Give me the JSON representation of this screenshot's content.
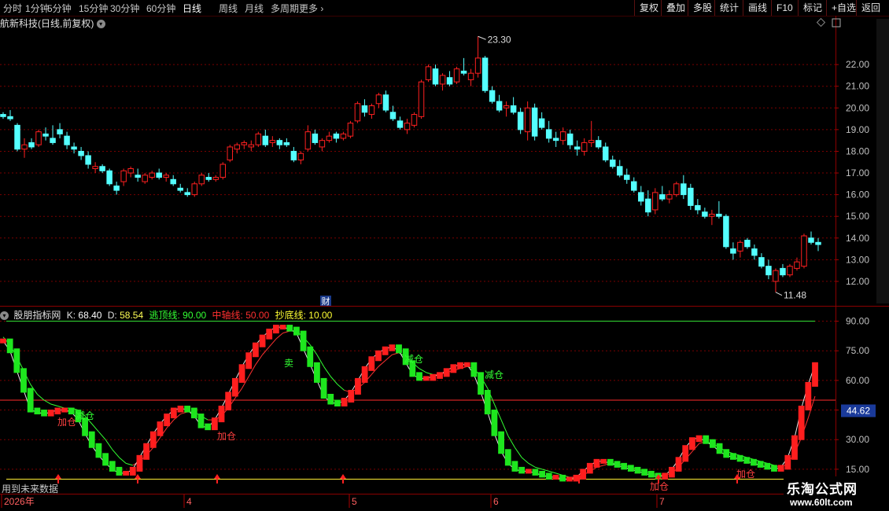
{
  "toolbar": {
    "periods": [
      "分时",
      "1分钟",
      "5分钟",
      "15分钟",
      "30分钟",
      "60分钟",
      "日线",
      "周线",
      "月线",
      "多周期",
      "更多"
    ],
    "active_period": "日线",
    "right_buttons": [
      "复权",
      "叠加",
      "多股",
      "统计",
      "画线",
      "F10",
      "标记",
      "+自选",
      "返回"
    ]
  },
  "main_title": "航新科技(日线,前复权)",
  "price_axis": [
    "22.00",
    "21.00",
    "20.00",
    "19.00",
    "18.00",
    "17.00",
    "16.00",
    "15.00",
    "14.00",
    "13.00",
    "12.00"
  ],
  "high_label": "23.30",
  "low_label": "11.48",
  "finance_marker": "财",
  "indicator": {
    "name": "股朋指标网",
    "k_label": "K:",
    "k_value": "68.40",
    "d_label": "D:",
    "d_value": "58.54",
    "escape_label": "逃顶线:",
    "escape_value": "90.00",
    "mid_label": "中轴线:",
    "mid_value": "50.00",
    "bottom_label": "抄底线:",
    "bottom_value": "10.00",
    "axis": [
      "90.00",
      "75.00",
      "60.00",
      "45.00",
      "30.00",
      "15.00"
    ],
    "current_value": "44.62",
    "annotations": {
      "jia_cang": "加仓",
      "jian_cang": "减仓",
      "mai": "卖"
    }
  },
  "future_data_text": "用到未来数据",
  "date_axis": [
    "2026年",
    "4",
    "5",
    "6",
    "7"
  ],
  "watermark": {
    "title": "乐淘公式网",
    "url": "www.60lt.com"
  },
  "colors": {
    "up": "#ff2020",
    "down": "#54ffff",
    "kd_up": "#ff1e1e",
    "kd_down": "#1ee61e",
    "grid": "#7a0000",
    "axis_text": "#c0c0c0"
  },
  "chart_data": [
    {
      "type": "candlestick",
      "ylim": [
        11.2,
        23.6
      ],
      "high": "23.30",
      "low": "11.48",
      "ohlc": [
        [
          19.7,
          19.8,
          19.5,
          19.6
        ],
        [
          19.6,
          19.9,
          19.4,
          19.5
        ],
        [
          19.2,
          19.3,
          18.0,
          18.1
        ],
        [
          18.1,
          18.6,
          17.7,
          18.3
        ],
        [
          18.4,
          18.6,
          18.1,
          18.2
        ],
        [
          18.3,
          19.0,
          18.2,
          18.9
        ],
        [
          18.8,
          19.1,
          18.5,
          18.7
        ],
        [
          18.6,
          19.2,
          18.3,
          18.4
        ],
        [
          19.0,
          19.3,
          18.6,
          18.8
        ],
        [
          18.7,
          18.9,
          18.1,
          18.3
        ],
        [
          18.2,
          18.4,
          17.9,
          18.1
        ],
        [
          18.0,
          18.2,
          17.6,
          17.8
        ],
        [
          17.8,
          18.0,
          17.2,
          17.4
        ],
        [
          17.2,
          17.5,
          17.0,
          17.3
        ],
        [
          17.3,
          17.4,
          17.0,
          17.1
        ],
        [
          17.1,
          17.2,
          16.4,
          16.5
        ],
        [
          16.4,
          16.6,
          16.0,
          16.2
        ],
        [
          16.6,
          17.2,
          16.4,
          17.1
        ],
        [
          17.0,
          17.3,
          16.8,
          17.2
        ],
        [
          16.9,
          17.2,
          16.6,
          16.8
        ],
        [
          16.6,
          17.0,
          16.5,
          16.9
        ],
        [
          16.8,
          17.1,
          16.7,
          17.0
        ],
        [
          17.0,
          17.2,
          16.7,
          16.8
        ],
        [
          16.8,
          17.0,
          16.6,
          16.9
        ],
        [
          16.7,
          16.9,
          16.4,
          16.5
        ],
        [
          16.3,
          16.5,
          16.1,
          16.2
        ],
        [
          16.1,
          16.3,
          15.9,
          16.0
        ],
        [
          16.0,
          16.6,
          15.9,
          16.5
        ],
        [
          16.5,
          17.0,
          16.4,
          16.9
        ],
        [
          16.8,
          17.0,
          16.6,
          16.7
        ],
        [
          16.7,
          16.9,
          16.6,
          16.8
        ],
        [
          16.8,
          17.5,
          16.7,
          17.4
        ],
        [
          17.6,
          18.3,
          17.5,
          18.2
        ],
        [
          18.1,
          18.4,
          17.9,
          18.3
        ],
        [
          18.3,
          18.5,
          18.1,
          18.4
        ],
        [
          18.2,
          18.5,
          18.0,
          18.3
        ],
        [
          18.3,
          18.9,
          18.2,
          18.8
        ],
        [
          18.7,
          19.0,
          18.2,
          18.3
        ],
        [
          18.4,
          18.7,
          18.2,
          18.5
        ],
        [
          18.5,
          18.6,
          18.1,
          18.3
        ],
        [
          18.4,
          18.6,
          18.2,
          18.3
        ],
        [
          18.0,
          18.2,
          17.5,
          17.6
        ],
        [
          17.6,
          18.0,
          17.4,
          17.9
        ],
        [
          18.1,
          19.2,
          18.0,
          18.9
        ],
        [
          18.8,
          19.0,
          18.3,
          18.4
        ],
        [
          18.2,
          18.6,
          18.0,
          18.5
        ],
        [
          18.5,
          18.9,
          18.4,
          18.7
        ],
        [
          18.8,
          18.9,
          18.4,
          18.6
        ],
        [
          18.6,
          18.9,
          18.5,
          18.8
        ],
        [
          18.7,
          19.4,
          18.6,
          19.3
        ],
        [
          19.4,
          20.3,
          19.3,
          20.2
        ],
        [
          20.1,
          20.4,
          19.6,
          19.8
        ],
        [
          19.7,
          20.2,
          19.5,
          20.1
        ],
        [
          20.2,
          20.7,
          20.0,
          20.6
        ],
        [
          20.6,
          20.8,
          19.8,
          19.9
        ],
        [
          19.8,
          20.1,
          19.4,
          19.5
        ],
        [
          19.4,
          19.6,
          19.0,
          19.1
        ],
        [
          19.0,
          19.5,
          18.8,
          19.3
        ],
        [
          19.2,
          19.8,
          19.1,
          19.7
        ],
        [
          19.6,
          21.3,
          19.5,
          21.2
        ],
        [
          21.3,
          22.0,
          21.2,
          21.9
        ],
        [
          21.8,
          22.0,
          21.0,
          21.1
        ],
        [
          21.1,
          21.6,
          20.8,
          21.5
        ],
        [
          21.4,
          21.7,
          21.0,
          21.1
        ],
        [
          21.2,
          21.9,
          21.1,
          21.8
        ],
        [
          21.7,
          22.3,
          21.5,
          21.6
        ],
        [
          21.3,
          21.8,
          21.0,
          21.6
        ],
        [
          21.6,
          23.3,
          21.4,
          22.3
        ],
        [
          22.3,
          22.4,
          20.7,
          20.8
        ],
        [
          20.8,
          21.0,
          20.2,
          20.3
        ],
        [
          20.3,
          20.6,
          19.8,
          19.9
        ],
        [
          20.0,
          20.3,
          19.6,
          20.1
        ],
        [
          20.1,
          20.5,
          19.7,
          19.8
        ],
        [
          19.8,
          20.0,
          18.8,
          19.0
        ],
        [
          18.9,
          20.3,
          18.5,
          20.0
        ],
        [
          20.0,
          20.2,
          18.5,
          18.7
        ],
        [
          19.5,
          19.8,
          19.0,
          19.1
        ],
        [
          19.0,
          19.4,
          18.4,
          18.6
        ],
        [
          18.6,
          18.9,
          18.2,
          18.5
        ],
        [
          18.5,
          19.1,
          18.3,
          18.9
        ],
        [
          18.8,
          19.0,
          18.1,
          18.3
        ],
        [
          18.2,
          18.5,
          17.8,
          18.1
        ],
        [
          18.0,
          18.6,
          17.8,
          18.4
        ],
        [
          18.4,
          19.4,
          18.2,
          18.5
        ],
        [
          18.5,
          18.7,
          18.1,
          18.2
        ],
        [
          18.2,
          18.4,
          17.5,
          17.6
        ],
        [
          17.6,
          17.8,
          17.2,
          17.3
        ],
        [
          17.3,
          17.6,
          16.8,
          16.9
        ],
        [
          16.9,
          17.2,
          16.5,
          16.7
        ],
        [
          16.6,
          16.8,
          16.1,
          16.2
        ],
        [
          16.1,
          16.4,
          15.5,
          15.7
        ],
        [
          15.8,
          16.2,
          15.0,
          15.2
        ],
        [
          15.3,
          16.3,
          15.1,
          16.1
        ],
        [
          16.0,
          16.4,
          15.7,
          15.8
        ],
        [
          15.8,
          16.2,
          15.6,
          16.0
        ],
        [
          16.0,
          16.6,
          15.9,
          16.5
        ],
        [
          16.5,
          16.9,
          15.8,
          16.0
        ],
        [
          16.3,
          16.5,
          15.3,
          15.5
        ],
        [
          15.5,
          15.8,
          15.1,
          15.3
        ],
        [
          15.2,
          15.4,
          14.9,
          15.0
        ],
        [
          15.0,
          15.3,
          14.6,
          15.1
        ],
        [
          15.1,
          15.7,
          14.9,
          15.0
        ],
        [
          15.0,
          15.1,
          13.5,
          13.6
        ],
        [
          13.5,
          13.8,
          13.0,
          13.3
        ],
        [
          13.4,
          13.9,
          13.1,
          13.8
        ],
        [
          13.9,
          14.0,
          13.5,
          13.6
        ],
        [
          13.5,
          13.7,
          13.0,
          13.2
        ],
        [
          13.1,
          13.3,
          12.6,
          12.7
        ],
        [
          12.7,
          13.0,
          12.1,
          12.3
        ],
        [
          12.0,
          12.6,
          11.5,
          12.5
        ],
        [
          12.6,
          12.8,
          12.2,
          12.3
        ],
        [
          12.3,
          12.8,
          12.2,
          12.7
        ],
        [
          12.6,
          13.1,
          12.5,
          12.9
        ],
        [
          12.7,
          14.2,
          12.6,
          14.1
        ],
        [
          14.0,
          14.3,
          13.7,
          13.8
        ],
        [
          13.8,
          14.0,
          13.4,
          13.7
        ]
      ]
    },
    {
      "type": "line",
      "title": "股朋指标网",
      "ylim": [
        0,
        100
      ],
      "reference_lines": [
        {
          "name": "逃顶线",
          "value": 90
        },
        {
          "name": "中轴线",
          "value": 50
        },
        {
          "name": "抄底线",
          "value": 10
        }
      ],
      "series": [
        {
          "name": "K",
          "values": [
            80,
            75,
            65,
            55,
            45,
            44,
            43,
            44,
            45,
            45,
            44,
            40,
            33,
            27,
            22,
            18,
            15,
            13,
            13,
            15,
            21,
            27,
            33,
            38,
            42,
            45,
            46,
            45,
            42,
            37,
            36,
            40,
            46,
            53,
            60,
            67,
            73,
            78,
            82,
            85,
            87,
            87,
            86,
            84,
            76,
            68,
            60,
            52,
            49,
            48,
            50,
            54,
            60,
            66,
            71,
            74,
            76,
            77,
            75,
            69,
            63,
            61,
            61,
            62,
            63,
            65,
            67,
            68,
            68,
            63,
            54,
            44,
            33,
            24,
            18,
            15,
            14,
            14,
            13,
            12,
            11,
            11,
            10,
            10,
            11,
            14,
            17,
            19,
            19,
            18,
            17,
            16,
            15,
            14,
            13,
            12,
            11,
            12,
            15,
            20,
            26,
            30,
            31,
            29,
            27,
            24,
            22,
            21,
            20,
            19,
            18,
            17,
            16,
            15,
            16,
            21,
            31,
            46,
            58,
            68
          ]
        },
        {
          "name": "D",
          "values": [
            82,
            78,
            72,
            65,
            58,
            53,
            50,
            48,
            47,
            46,
            46,
            45,
            42,
            38,
            34,
            30,
            25,
            21,
            18,
            17,
            19,
            22,
            26,
            31,
            36,
            40,
            43,
            44,
            44,
            42,
            40,
            40,
            42,
            46,
            51,
            56,
            62,
            68,
            73,
            77,
            81,
            84,
            85,
            85,
            82,
            78,
            73,
            67,
            62,
            58,
            55,
            54,
            56,
            59,
            63,
            67,
            70,
            73,
            74,
            72,
            69,
            66,
            64,
            63,
            63,
            64,
            65,
            66,
            67,
            66,
            62,
            56,
            48,
            40,
            32,
            26,
            21,
            18,
            16,
            15,
            14,
            13,
            12,
            11,
            11,
            12,
            14,
            16,
            17,
            18,
            18,
            17,
            16,
            15,
            14,
            13,
            12,
            12,
            13,
            16,
            20,
            24,
            28,
            29,
            28,
            26,
            24,
            23,
            22,
            21,
            20,
            19,
            18,
            17,
            16,
            18,
            23,
            31,
            41,
            52
          ]
        }
      ],
      "current_value": "44.62"
    }
  ]
}
